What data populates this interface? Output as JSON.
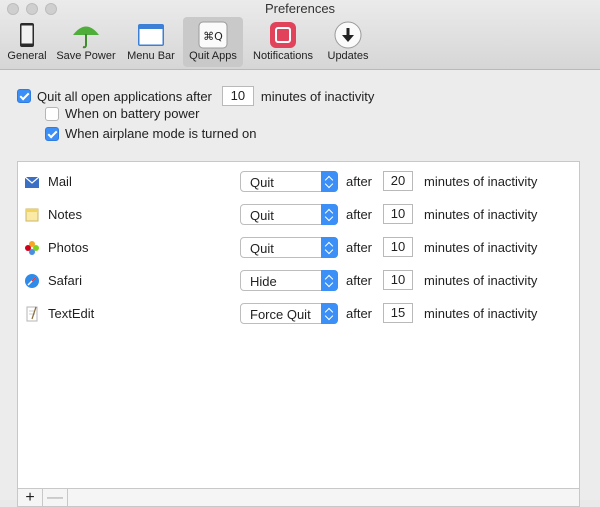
{
  "window": {
    "title": "Preferences"
  },
  "toolbar": {
    "items": [
      {
        "label": "General",
        "icon": "phone-icon"
      },
      {
        "label": "Save Power",
        "icon": "umbrella-icon"
      },
      {
        "label": "Menu Bar",
        "icon": "window-icon"
      },
      {
        "label": "Quit Apps",
        "icon": "command-q-icon",
        "icon_text": "⌘Q",
        "active": true
      },
      {
        "label": "Notifications",
        "icon": "notification-icon"
      },
      {
        "label": "Updates",
        "icon": "download-icon"
      }
    ]
  },
  "settings": {
    "quit_all_label_pre": "Quit all open applications after",
    "quit_all_minutes": "10",
    "quit_all_label_post": "minutes of inactivity",
    "quit_all_checked": true,
    "battery_label": "When on battery power",
    "battery_checked": false,
    "airplane_label": "When airplane mode is turned on",
    "airplane_checked": true
  },
  "apps": [
    {
      "name": "Mail",
      "action": "Quit",
      "after_label": "after",
      "minutes": "20",
      "minutes_label": "minutes of inactivity",
      "icon": "mail-icon"
    },
    {
      "name": "Notes",
      "action": "Quit",
      "after_label": "after",
      "minutes": "10",
      "minutes_label": "minutes of inactivity",
      "icon": "notes-icon"
    },
    {
      "name": "Photos",
      "action": "Quit",
      "after_label": "after",
      "minutes": "10",
      "minutes_label": "minutes of inactivity",
      "icon": "photos-icon"
    },
    {
      "name": "Safari",
      "action": "Hide",
      "after_label": "after",
      "minutes": "10",
      "minutes_label": "minutes of inactivity",
      "icon": "safari-icon"
    },
    {
      "name": "TextEdit",
      "action": "Force Quit",
      "after_label": "after",
      "minutes": "15",
      "minutes_label": "minutes of inactivity",
      "icon": "textedit-icon"
    }
  ],
  "footer": {
    "add_label": "+",
    "remove_label": "—"
  },
  "colors": {
    "accent": "#3b8ff6",
    "notifications_red": "#e0435a",
    "umbrella_green": "#4fae3a"
  }
}
